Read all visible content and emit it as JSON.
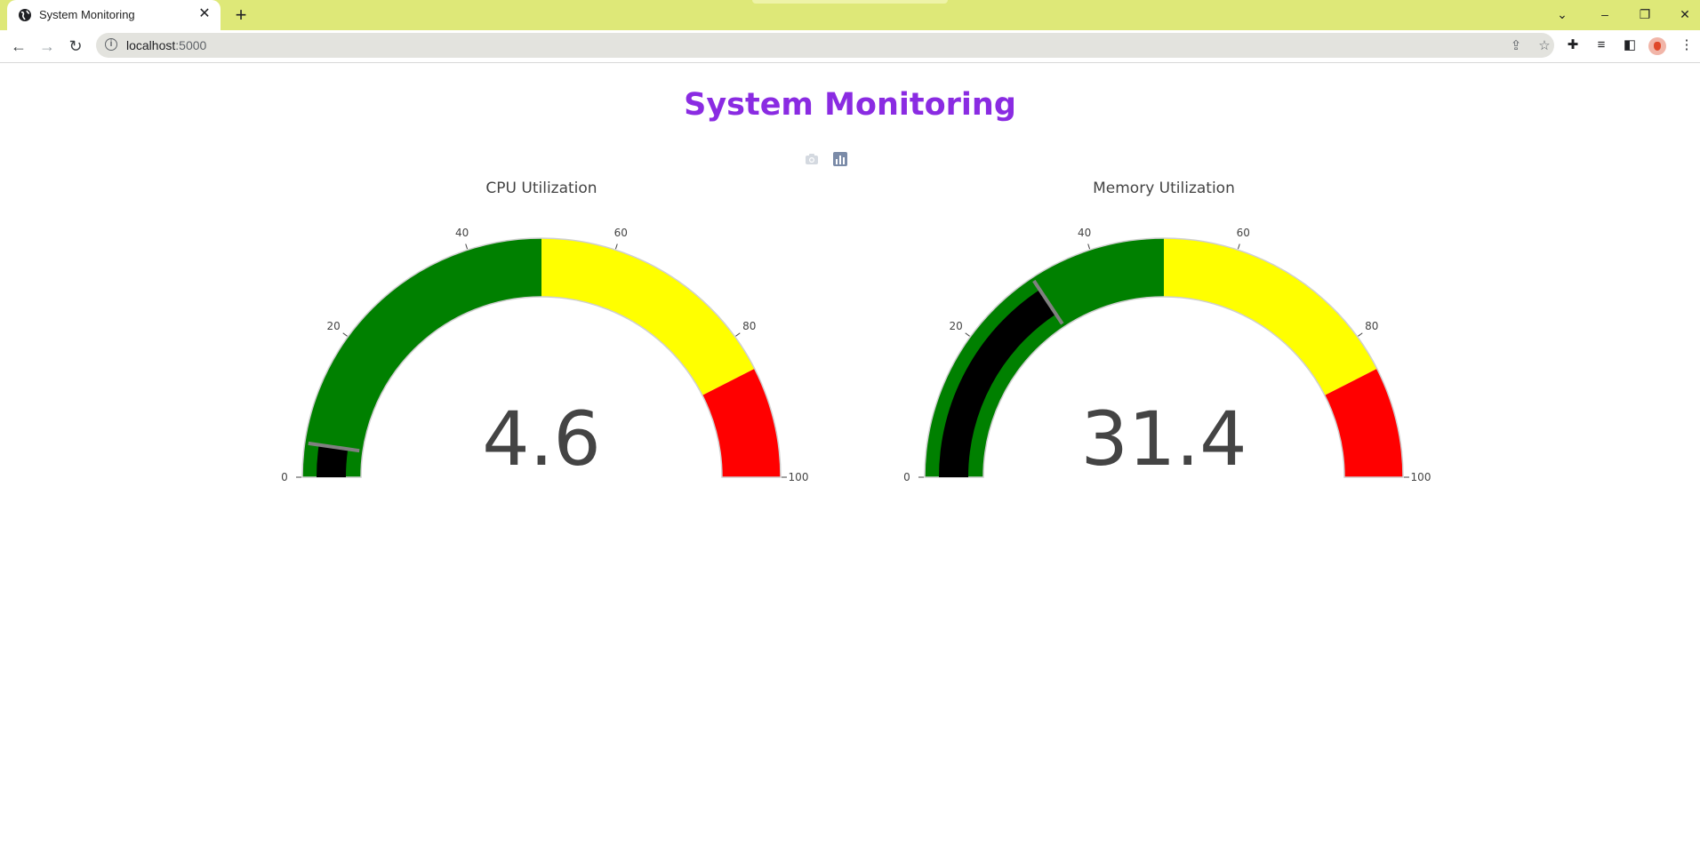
{
  "browser": {
    "tab_title": "System Monitoring",
    "url_host": "localhost",
    "url_port": ":5000"
  },
  "page": {
    "title": "System Monitoring"
  },
  "colors": {
    "title": "#8a2be2",
    "band_low": "#008000",
    "band_mid": "#ffff00",
    "band_high": "#ff0000",
    "bar": "#000000",
    "threshold": "#808080"
  },
  "chart_data": [
    {
      "type": "gauge",
      "title": "CPU Utilization",
      "value": 4.6,
      "value_label": "4.6",
      "range": [
        0,
        100
      ],
      "ticks": [
        0,
        20,
        40,
        60,
        80,
        100
      ],
      "steps": [
        {
          "range": [
            0,
            50
          ],
          "color": "green"
        },
        {
          "range": [
            50,
            85
          ],
          "color": "yellow"
        },
        {
          "range": [
            85,
            100
          ],
          "color": "red"
        }
      ],
      "bar_color": "black",
      "threshold": 4.6
    },
    {
      "type": "gauge",
      "title": "Memory Utilization",
      "value": 31.4,
      "value_label": "31.4",
      "range": [
        0,
        100
      ],
      "ticks": [
        0,
        20,
        40,
        60,
        80,
        100
      ],
      "steps": [
        {
          "range": [
            0,
            50
          ],
          "color": "green"
        },
        {
          "range": [
            50,
            85
          ],
          "color": "yellow"
        },
        {
          "range": [
            85,
            100
          ],
          "color": "red"
        }
      ],
      "bar_color": "black",
      "threshold": 31.4
    }
  ]
}
